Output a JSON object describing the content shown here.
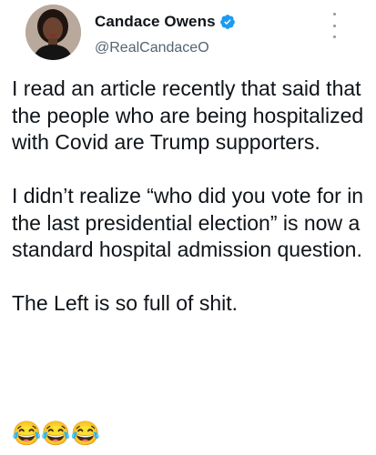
{
  "author": {
    "display_name": "Candace Owens",
    "handle": "@RealCandaceO",
    "verified": true,
    "verified_icon": "verified-badge-icon",
    "verified_color": "#1d9bf0"
  },
  "menu": {
    "icon": "more-vertical-icon"
  },
  "tweet": {
    "paragraphs": [
      "I read an article recently that said that the people who are being hospitalized with Covid are Trump supporters.",
      "I didn’t realize “who did you vote for in the last presidential election” is now a standard hospital admission question.",
      "The Left is so full of shit."
    ],
    "emojis": "😂😂😂"
  },
  "colors": {
    "text": "#0f1419",
    "secondary": "#536471",
    "background": "#ffffff"
  }
}
